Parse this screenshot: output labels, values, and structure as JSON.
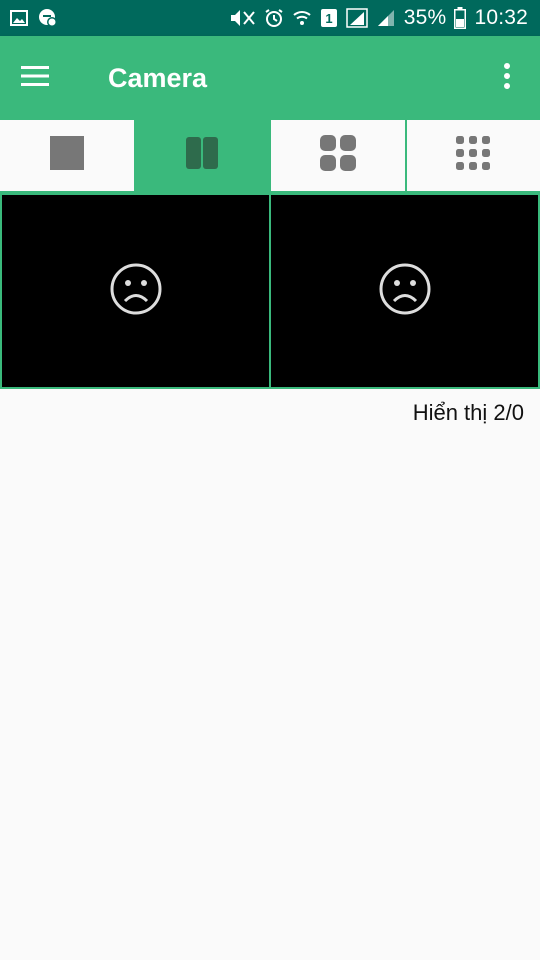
{
  "status_bar": {
    "battery_text": "35%",
    "time": "10:32",
    "sim_slot": "1",
    "icons": [
      "gallery-icon",
      "chat-notification-icon",
      "mute-icon",
      "alarm-icon",
      "wifi-icon",
      "sim-icon",
      "signal-icon",
      "signal-icon-2",
      "battery-icon"
    ]
  },
  "app_bar": {
    "title": "Camera",
    "menu_icon": "hamburger-menu-icon",
    "more_icon": "more-vertical-icon"
  },
  "layout_tabs": [
    {
      "name": "single-view",
      "icon": "single-square-icon",
      "active": false
    },
    {
      "name": "two-view",
      "icon": "two-column-icon",
      "active": true
    },
    {
      "name": "four-view",
      "icon": "four-grid-icon",
      "active": false
    },
    {
      "name": "nine-view",
      "icon": "nine-grid-icon",
      "active": false
    }
  ],
  "cameras": [
    {
      "state": "unavailable",
      "icon": "sad-face-icon"
    },
    {
      "state": "unavailable",
      "icon": "sad-face-icon"
    }
  ],
  "display_count": "Hiển thị 2/0",
  "colors": {
    "status_bar": "#00695c",
    "accent": "#3ab97c",
    "icon_gray": "#777777",
    "icon_active": "#2e6b4c",
    "camera_bg": "#000000"
  }
}
